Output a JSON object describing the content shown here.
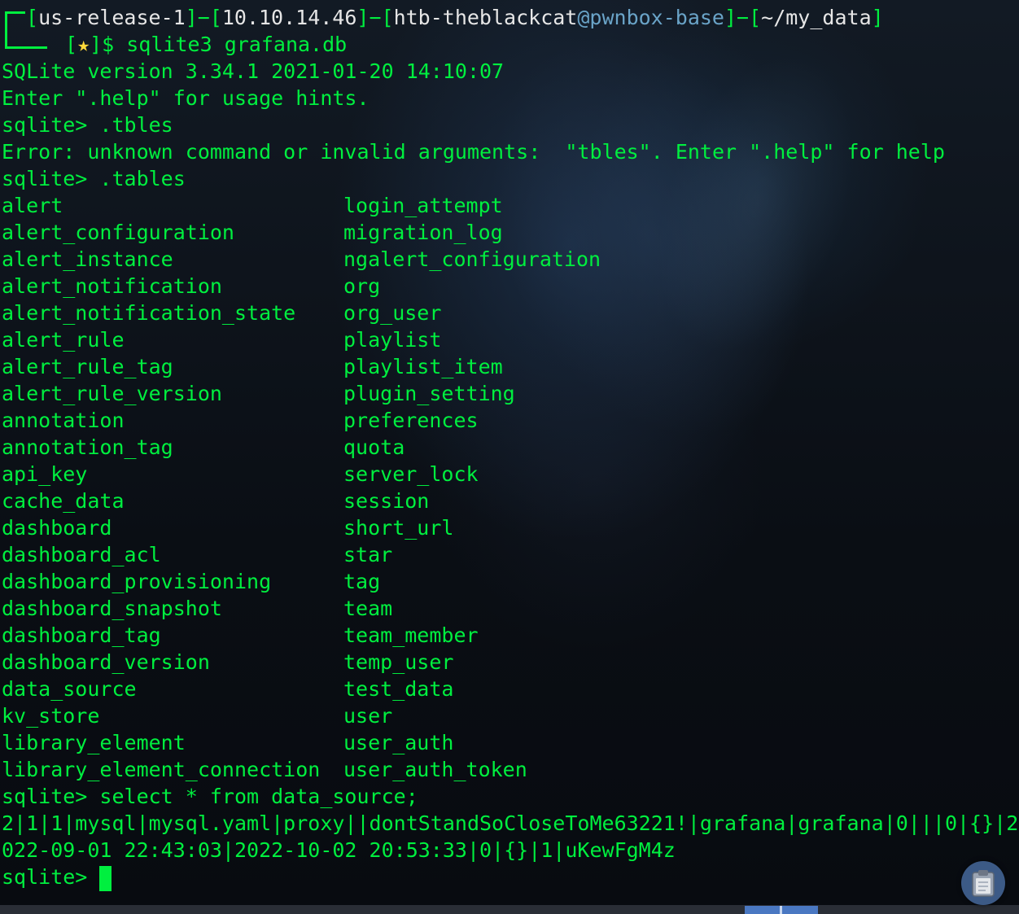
{
  "prompt": {
    "open_bracket_1": "[",
    "release": "us-release-1",
    "sep1": "]−[",
    "ip": "10.10.14.46",
    "sep2": "]−[",
    "user": "htb-theblackcat",
    "at": "@",
    "host": "pwnbox-base",
    "sep3": "]−[",
    "path": "~/my_data",
    "close_bracket": "]",
    "line2_prefix": "[",
    "star": "★",
    "line2_suffix": "]$ sqlite3 grafana.db"
  },
  "output": {
    "version_line": "SQLite version 3.34.1 2021-01-20 14:10:07",
    "hint_line": "Enter \".help\" for usage hints.",
    "cmd_typo": "sqlite> .tbles",
    "error_line": "Error: unknown command or invalid arguments:  \"tbles\". Enter \".help\" for help",
    "cmd_tables": "sqlite> .tables",
    "tables_left": [
      "alert",
      "alert_configuration",
      "alert_instance",
      "alert_notification",
      "alert_notification_state",
      "alert_rule",
      "alert_rule_tag",
      "alert_rule_version",
      "annotation",
      "annotation_tag",
      "api_key",
      "cache_data",
      "dashboard",
      "dashboard_acl",
      "dashboard_provisioning",
      "dashboard_snapshot",
      "dashboard_tag",
      "dashboard_version",
      "data_source",
      "kv_store",
      "library_element",
      "library_element_connection"
    ],
    "tables_right": [
      "login_attempt",
      "migration_log",
      "ngalert_configuration",
      "org",
      "org_user",
      "playlist",
      "playlist_item",
      "plugin_setting",
      "preferences",
      "quota",
      "server_lock",
      "session",
      "short_url",
      "star",
      "tag",
      "team",
      "team_member",
      "temp_user",
      "test_data",
      "user",
      "user_auth",
      "user_auth_token"
    ],
    "cmd_select": "sqlite> select * from data_source;",
    "result_line_1": "2|1|1|mysql|mysql.yaml|proxy||dontStandSoCloseToMe63221!|grafana|grafana|0|||0|{}|2",
    "result_line_2": "022-09-01 22:43:03|2022-10-02 20:53:33|0|{}|1|uKewFgM4z",
    "final_prompt": "sqlite> "
  },
  "colors": {
    "text_green": "#00ef3f",
    "host_text": "#e6e6e6",
    "at_sign": "#6aa4c8",
    "star": "#ffd83a",
    "background": "#0b0f16"
  },
  "icons": {
    "clipboard": "clipboard-icon"
  }
}
